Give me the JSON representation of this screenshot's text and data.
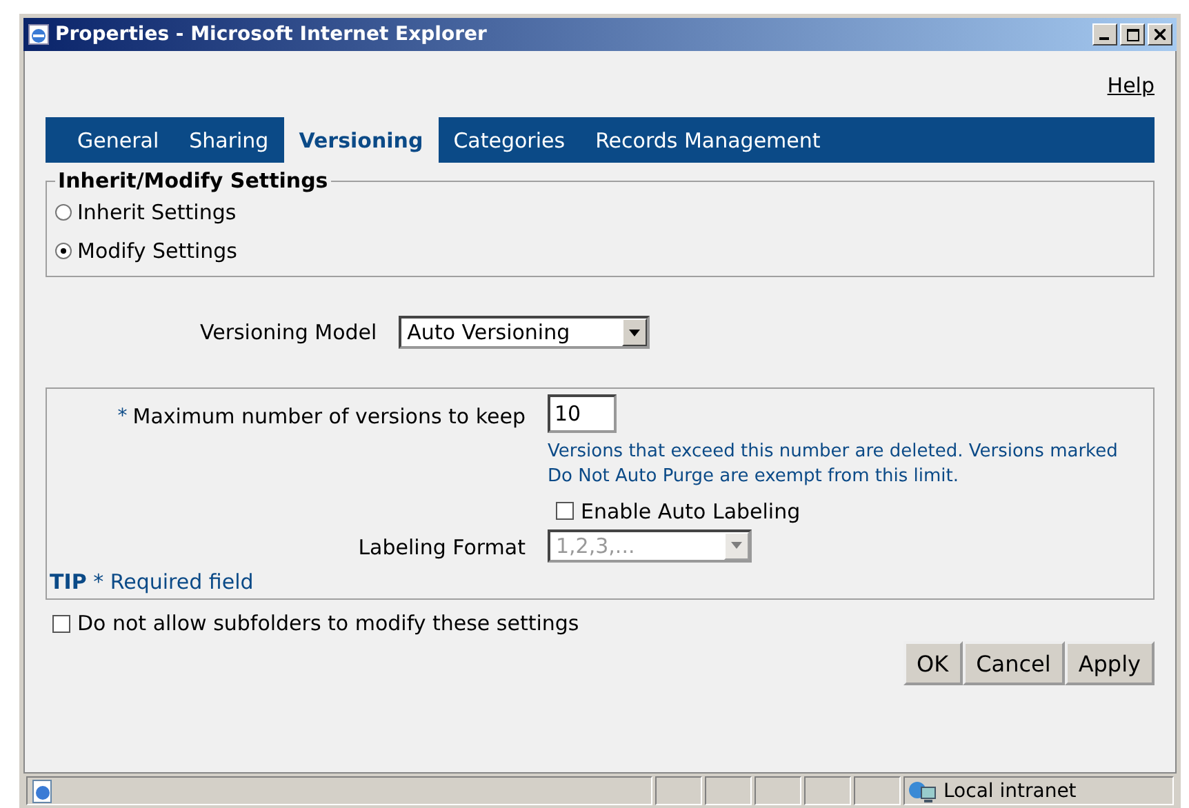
{
  "window": {
    "title": "Properties - Microsoft Internet Explorer"
  },
  "help_link": "Help",
  "tabs": [
    {
      "label": "General",
      "selected": false
    },
    {
      "label": "Sharing",
      "selected": false
    },
    {
      "label": "Versioning",
      "selected": true
    },
    {
      "label": "Categories",
      "selected": false
    },
    {
      "label": "Records Management",
      "selected": false
    }
  ],
  "inherit_group": {
    "legend": "Inherit/Modify Settings",
    "options": [
      {
        "label": "Inherit Settings",
        "selected": false
      },
      {
        "label": "Modify Settings",
        "selected": true
      }
    ]
  },
  "versioning_model": {
    "label": "Versioning Model",
    "value": "Auto Versioning"
  },
  "max_versions": {
    "required_mark": "*",
    "label": "Maximum number of versions to keep",
    "value": "10",
    "help": "Versions that exceed this number are deleted. Versions marked Do Not Auto Purge are exempt from this limit."
  },
  "auto_labeling": {
    "label": "Enable Auto Labeling",
    "checked": false
  },
  "labeling_format": {
    "label": "Labeling Format",
    "value": "1,2,3,...",
    "disabled": true
  },
  "tip": {
    "prefix": "TIP",
    "text": "* Required field"
  },
  "subfolders": {
    "label": "Do not allow subfolders to modify these settings",
    "checked": false
  },
  "buttons": [
    "OK",
    "Cancel",
    "Apply"
  ],
  "status_bar": {
    "zone": "Local intranet"
  }
}
